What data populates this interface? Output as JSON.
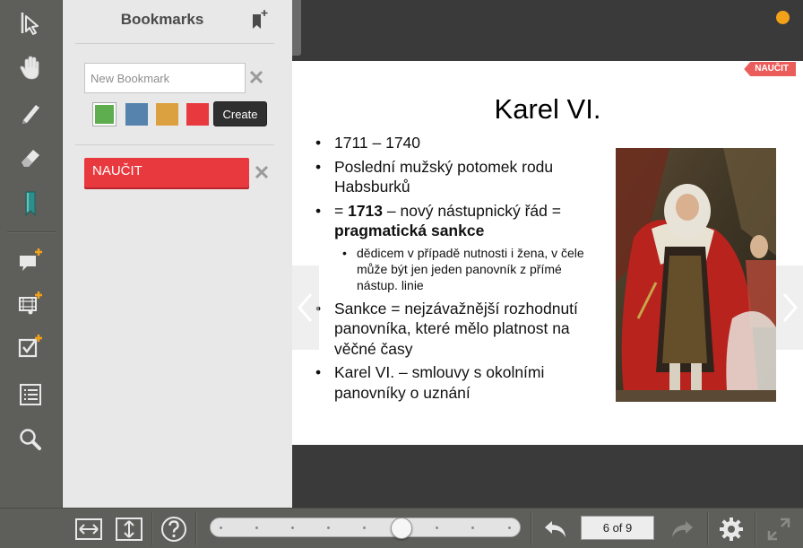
{
  "panel": {
    "title": "Bookmarks",
    "new_bookmark_placeholder": "New Bookmark",
    "create_label": "Create",
    "swatch_colors": [
      "#5ead4f",
      "#5583ad",
      "#dba03f",
      "#e8393f"
    ],
    "bookmarks": [
      {
        "label": "NAUČIT",
        "color": "#e8393f"
      }
    ]
  },
  "toolbar": {
    "icons": [
      "pointer-icon",
      "hand-icon",
      "pen-icon",
      "eraser-icon",
      "bookmark-icon",
      "add-comment-icon",
      "add-media-icon",
      "add-task-icon",
      "list-icon",
      "search-icon",
      "exit-icon"
    ]
  },
  "slide": {
    "ribbon_label": "NAUČIT",
    "title": "Karel VI.",
    "bullets": {
      "b1": "1711 – 1740",
      "b2": "Poslední mužský potomek rodu Habsburků",
      "b3_pre": "= ",
      "b3_bold_year": "1713",
      "b3_mid": " – nový nástupnický řád = ",
      "b3_bold_term": "pragmatická sankce",
      "b3_sub": "dědicem v případě nutnosti i žena, v čele může být jen jeden panovník z přímé nástup. linie",
      "b4": "Sankce = nejzávažnější rozhodnutí panovníka, které mělo platnost na věčné časy",
      "b5": "Karel VI. – smlouvy s okolními panovníky o uznání"
    }
  },
  "footer": {
    "page_indicator": "6 of 9",
    "current_page": 6,
    "total_pages": 9
  },
  "colors": {
    "accent_orange": "#f4a11a",
    "bookmark_red": "#e8393f"
  }
}
